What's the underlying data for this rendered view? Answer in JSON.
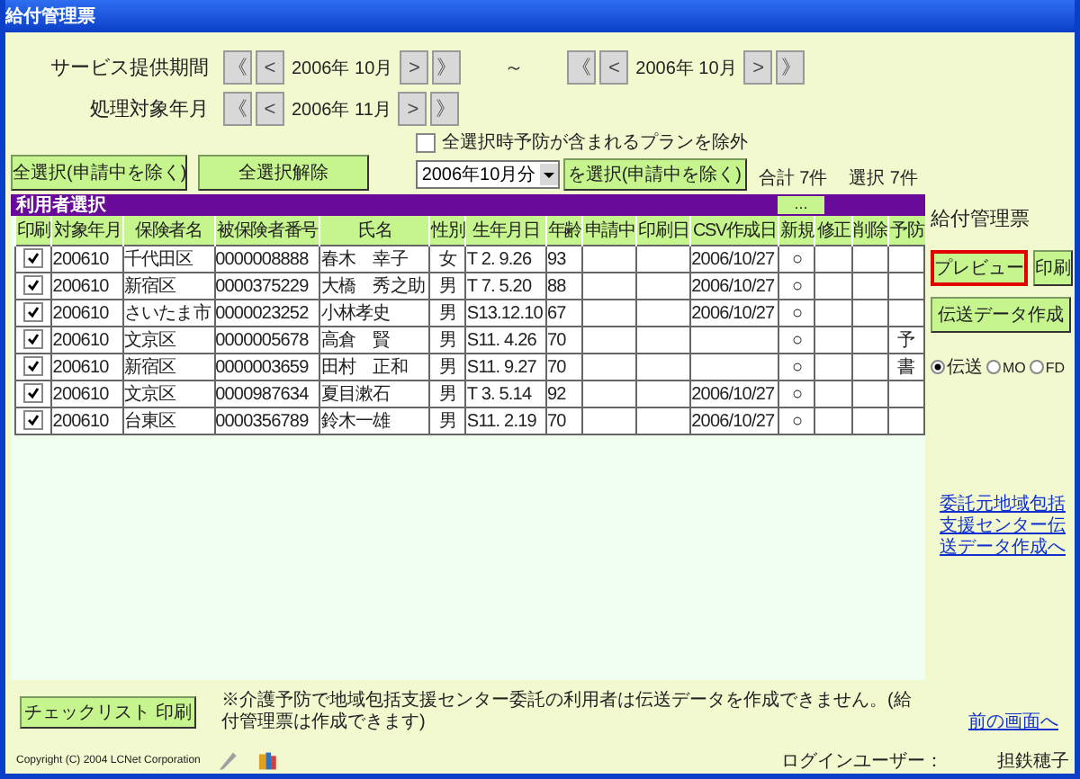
{
  "window": {
    "title": "給付管理票"
  },
  "service_period": {
    "label": "サービス提供期間",
    "from": {
      "prev_year": "《",
      "prev": "<",
      "value": "2006年 10月",
      "next": ">",
      "next_year": "》"
    },
    "separator": "～",
    "to": {
      "prev_year": "《",
      "prev": "<",
      "value": "2006年 10月",
      "next": ">",
      "next_year": "》"
    }
  },
  "processing_month": {
    "label": "処理対象年月",
    "prev_year": "《",
    "prev": "<",
    "value": "2006年 11月",
    "next": ">",
    "next_year": "》"
  },
  "select_all_button": "全選択(申請中を除く)",
  "deselect_all_button": "全選択解除",
  "exclude_prevention": {
    "label": "全選択時予防が含まれるプランを除外",
    "checked": false
  },
  "month_select": {
    "value": "2006年10月分"
  },
  "select_month_button": "を選択(申請中を除く)",
  "total": "合計 7件",
  "selected_count": "選択 7件",
  "user_table": {
    "title": "利用者選択",
    "more_button": "…",
    "columns": [
      {
        "label": "印刷",
        "kind": "checkbox"
      },
      {
        "label": "対象年月",
        "kind": "text"
      },
      {
        "label": "保険者名",
        "kind": "text"
      },
      {
        "label": "被保険者番号",
        "kind": "text"
      },
      {
        "label": "氏名",
        "kind": "text"
      },
      {
        "label": "性別",
        "kind": "center"
      },
      {
        "label": "生年月日",
        "kind": "text"
      },
      {
        "label": "年齢",
        "kind": "text"
      },
      {
        "label": "申請中",
        "kind": "text"
      },
      {
        "label": "印刷日",
        "kind": "text"
      },
      {
        "label": "CSV作成日",
        "kind": "text"
      },
      {
        "label": "新規",
        "kind": "center"
      },
      {
        "label": "修正",
        "kind": "center"
      },
      {
        "label": "削除",
        "kind": "center"
      },
      {
        "label": "予防",
        "kind": "center"
      }
    ],
    "rows": [
      {
        "checked": true,
        "cells": [
          null,
          "200610",
          "千代田区",
          "0000008888",
          "春木　幸子",
          "女",
          "T 2. 9.26",
          "93",
          null,
          null,
          "2006/10/27",
          "○",
          null,
          null,
          null
        ]
      },
      {
        "checked": true,
        "cells": [
          null,
          "200610",
          "新宿区",
          "0000375229",
          "大橋　秀之助",
          "男",
          "T 7. 5.20",
          "88",
          null,
          null,
          "2006/10/27",
          "○",
          null,
          null,
          null
        ]
      },
      {
        "checked": true,
        "cells": [
          null,
          "200610",
          "さいたま市",
          "0000023252",
          "小林孝史",
          "男",
          "S13.12.10",
          "67",
          null,
          null,
          "2006/10/27",
          "○",
          null,
          null,
          null
        ]
      },
      {
        "checked": true,
        "cells": [
          null,
          "200610",
          "文京区",
          "0000005678",
          "高倉　賢",
          "男",
          "S11. 4.26",
          "70",
          null,
          null,
          null,
          "○",
          null,
          null,
          "予"
        ]
      },
      {
        "checked": true,
        "cells": [
          null,
          "200610",
          "新宿区",
          "0000003659",
          "田村　正和",
          "男",
          "S11. 9.27",
          "70",
          null,
          null,
          null,
          "○",
          null,
          null,
          "書"
        ]
      },
      {
        "checked": true,
        "cells": [
          null,
          "200610",
          "文京区",
          "0000987634",
          "夏目漱石",
          "男",
          "T 3. 5.14",
          "92",
          null,
          null,
          "2006/10/27",
          "○",
          null,
          null,
          null
        ]
      },
      {
        "checked": true,
        "cells": [
          null,
          "200610",
          "台東区",
          "0000356789",
          "鈴木一雄",
          "男",
          "S11. 2.19",
          "70",
          null,
          null,
          "2006/10/27",
          "○",
          null,
          null,
          null
        ]
      }
    ]
  },
  "side_panel": {
    "title": "給付管理票",
    "preview_button": {
      "label": "プレビュー",
      "focused": true
    },
    "print_button": "印刷",
    "transmit_button": "伝送データ作成",
    "media": [
      {
        "label": "伝送",
        "selected": true
      },
      {
        "label": "MO",
        "selected": false
      },
      {
        "label": "FD",
        "selected": false
      }
    ],
    "link": "委託元地域包括支援センター伝送データ作成へ"
  },
  "checklist_button": "チェックリスト 印刷",
  "note": "※介護予防で地域包括支援センター委託の利用者は伝送データを作成できません。(給付管理票は作成できます)",
  "back_link": "前の画面へ",
  "footer": {
    "copyright": "Copyright (C) 2004 LCNet Corporation",
    "login_label": "ログインユーザー：",
    "user": "担鉄穂子"
  }
}
